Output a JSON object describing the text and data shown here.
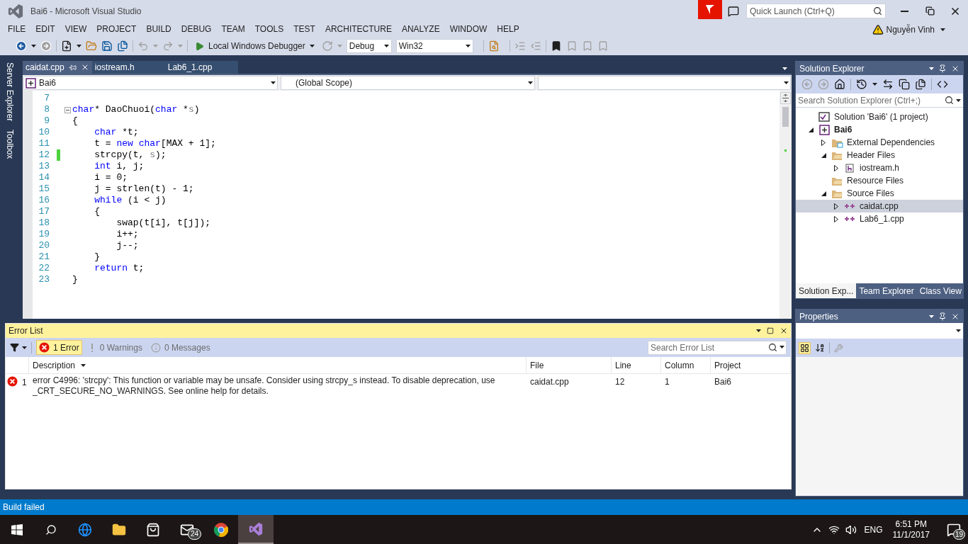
{
  "window": {
    "title": "Bai6 - Microsoft Visual Studio",
    "quick_launch": {
      "placeholder": "Quick Launch (Ctrl+Q)"
    },
    "user": "Nguyễn Vinh"
  },
  "menu": [
    "FILE",
    "EDIT",
    "VIEW",
    "PROJECT",
    "BUILD",
    "DEBUG",
    "TEAM",
    "TOOLS",
    "TEST",
    "ARCHITECTURE",
    "ANALYZE",
    "WINDOW",
    "HELP"
  ],
  "toolbar": {
    "debugger": "Local Windows Debugger",
    "configuration": "Debug",
    "platform": "Win32"
  },
  "side_tabs": [
    "Server Explorer",
    "Toolbox"
  ],
  "editor": {
    "tabs": [
      {
        "label": "caidat.cpp",
        "selected": true
      },
      {
        "label": "iostream.h",
        "selected": false
      },
      {
        "label": "Lab6_1.cpp",
        "selected": false
      }
    ],
    "project_dropdown": "Bai6",
    "scope_dropdown": "(Global Scope)",
    "lines": [
      {
        "number": "7"
      },
      {
        "number": "8",
        "fold_start": true,
        "tokens": [
          {
            "kind": "kw",
            "text": "char"
          },
          {
            "kind": "text",
            "text": "* DaoChuoi("
          },
          {
            "kind": "kw",
            "text": "char"
          },
          {
            "kind": "text",
            "text": " *"
          },
          {
            "kind": "param",
            "text": "s"
          },
          {
            "kind": "text",
            "text": ")"
          }
        ]
      },
      {
        "number": "9",
        "tokens": [
          {
            "kind": "text",
            "text": "{"
          }
        ]
      },
      {
        "number": "10",
        "tokens": [
          {
            "kind": "kw",
            "text": "    char"
          },
          {
            "kind": "text",
            "text": " *t;"
          }
        ]
      },
      {
        "number": "11",
        "tokens": [
          {
            "kind": "text",
            "text": "    t = "
          },
          {
            "kind": "kw",
            "text": "new"
          },
          {
            "kind": "kw",
            "text": " char"
          },
          {
            "kind": "text",
            "text": "[MAX + 1];"
          }
        ]
      },
      {
        "number": "12",
        "modified": true,
        "tokens": [
          {
            "kind": "text",
            "text": "    strcpy(t, "
          },
          {
            "kind": "param",
            "text": "s"
          },
          {
            "kind": "text",
            "text": ");"
          }
        ]
      },
      {
        "number": "13",
        "tokens": [
          {
            "kind": "kw",
            "text": "    int"
          },
          {
            "kind": "text",
            "text": " i, j;"
          }
        ]
      },
      {
        "number": "14",
        "tokens": [
          {
            "kind": "text",
            "text": "    i = 0;"
          }
        ]
      },
      {
        "number": "15",
        "tokens": [
          {
            "kind": "text",
            "text": "    j = strlen(t) - 1;"
          }
        ]
      },
      {
        "number": "16",
        "tokens": [
          {
            "kind": "kw",
            "text": "    while"
          },
          {
            "kind": "text",
            "text": " (i < j)"
          }
        ]
      },
      {
        "number": "17",
        "tokens": [
          {
            "kind": "text",
            "text": "    {"
          }
        ]
      },
      {
        "number": "18",
        "tokens": [
          {
            "kind": "text",
            "text": "        swap(t[i], t[j]);"
          }
        ]
      },
      {
        "number": "19",
        "tokens": [
          {
            "kind": "text",
            "text": "        i++;"
          }
        ]
      },
      {
        "number": "20",
        "tokens": [
          {
            "kind": "text",
            "text": "        j--;"
          }
        ]
      },
      {
        "number": "21",
        "tokens": [
          {
            "kind": "text",
            "text": "    }"
          }
        ]
      },
      {
        "number": "22",
        "tokens": [
          {
            "kind": "kw",
            "text": "    return"
          },
          {
            "kind": "text",
            "text": " t;"
          }
        ]
      },
      {
        "number": "23",
        "tokens": [
          {
            "kind": "text",
            "text": "}"
          }
        ]
      }
    ]
  },
  "solution_explorer": {
    "title": "Solution Explorer",
    "search": {
      "placeholder": "Search Solution Explorer (Ctrl+;)"
    },
    "tree": [
      {
        "label": "Solution 'Bai6' (1 project)",
        "kind": "solution",
        "selected": false,
        "children": [
          {
            "label": "Bai6",
            "kind": "project",
            "expanded": true,
            "selected": false,
            "children": [
              {
                "label": "External Dependencies",
                "kind": "external",
                "expanded": false,
                "selected": false
              },
              {
                "label": "Header Files",
                "kind": "folder",
                "expanded": true,
                "selected": false,
                "children": [
                  {
                    "label": "iostream.h",
                    "kind": "header",
                    "expanded": false,
                    "selected": false
                  }
                ]
              },
              {
                "label": "Resource Files",
                "kind": "folder",
                "selected": false
              },
              {
                "label": "Source Files",
                "kind": "folder",
                "expanded": true,
                "selected": false,
                "children": [
                  {
                    "label": "caidat.cpp",
                    "kind": "cpp",
                    "expanded": false,
                    "selected": true
                  },
                  {
                    "label": "Lab6_1.cpp",
                    "kind": "cpp",
                    "expanded": false,
                    "selected": false
                  }
                ]
              }
            ]
          }
        ]
      }
    ],
    "tabs": [
      {
        "label": "Solution Exp...",
        "selected": true
      },
      {
        "label": "Team Explorer",
        "selected": false
      },
      {
        "label": "Class View",
        "selected": false
      }
    ]
  },
  "properties": {
    "title": "Properties"
  },
  "error_list": {
    "title": "Error List",
    "filters": [
      {
        "label": "1 Error",
        "kind": "error",
        "selected": true
      },
      {
        "label": "0 Warnings",
        "kind": "warning",
        "selected": false
      },
      {
        "label": "0 Messages",
        "kind": "message",
        "selected": false
      }
    ],
    "search": {
      "placeholder": "Search Error List"
    },
    "columns": [
      "Description",
      "File",
      "Line",
      "Column",
      "Project"
    ],
    "rows": [
      {
        "number": "1",
        "description": "error C4996: 'strcpy': This function or variable may be unsafe. Consider using strcpy_s instead. To disable deprecation, use _CRT_SECURE_NO_WARNINGS. See online help for details.",
        "file": "caidat.cpp",
        "line": "12",
        "column": "1",
        "project": "Bai6"
      }
    ]
  },
  "status_bar": "Build failed",
  "taskbar": {
    "mail_badge": "24",
    "language": "ENG",
    "time": "6:51 PM",
    "date": "11/1/2017",
    "notification_badge": "19"
  }
}
